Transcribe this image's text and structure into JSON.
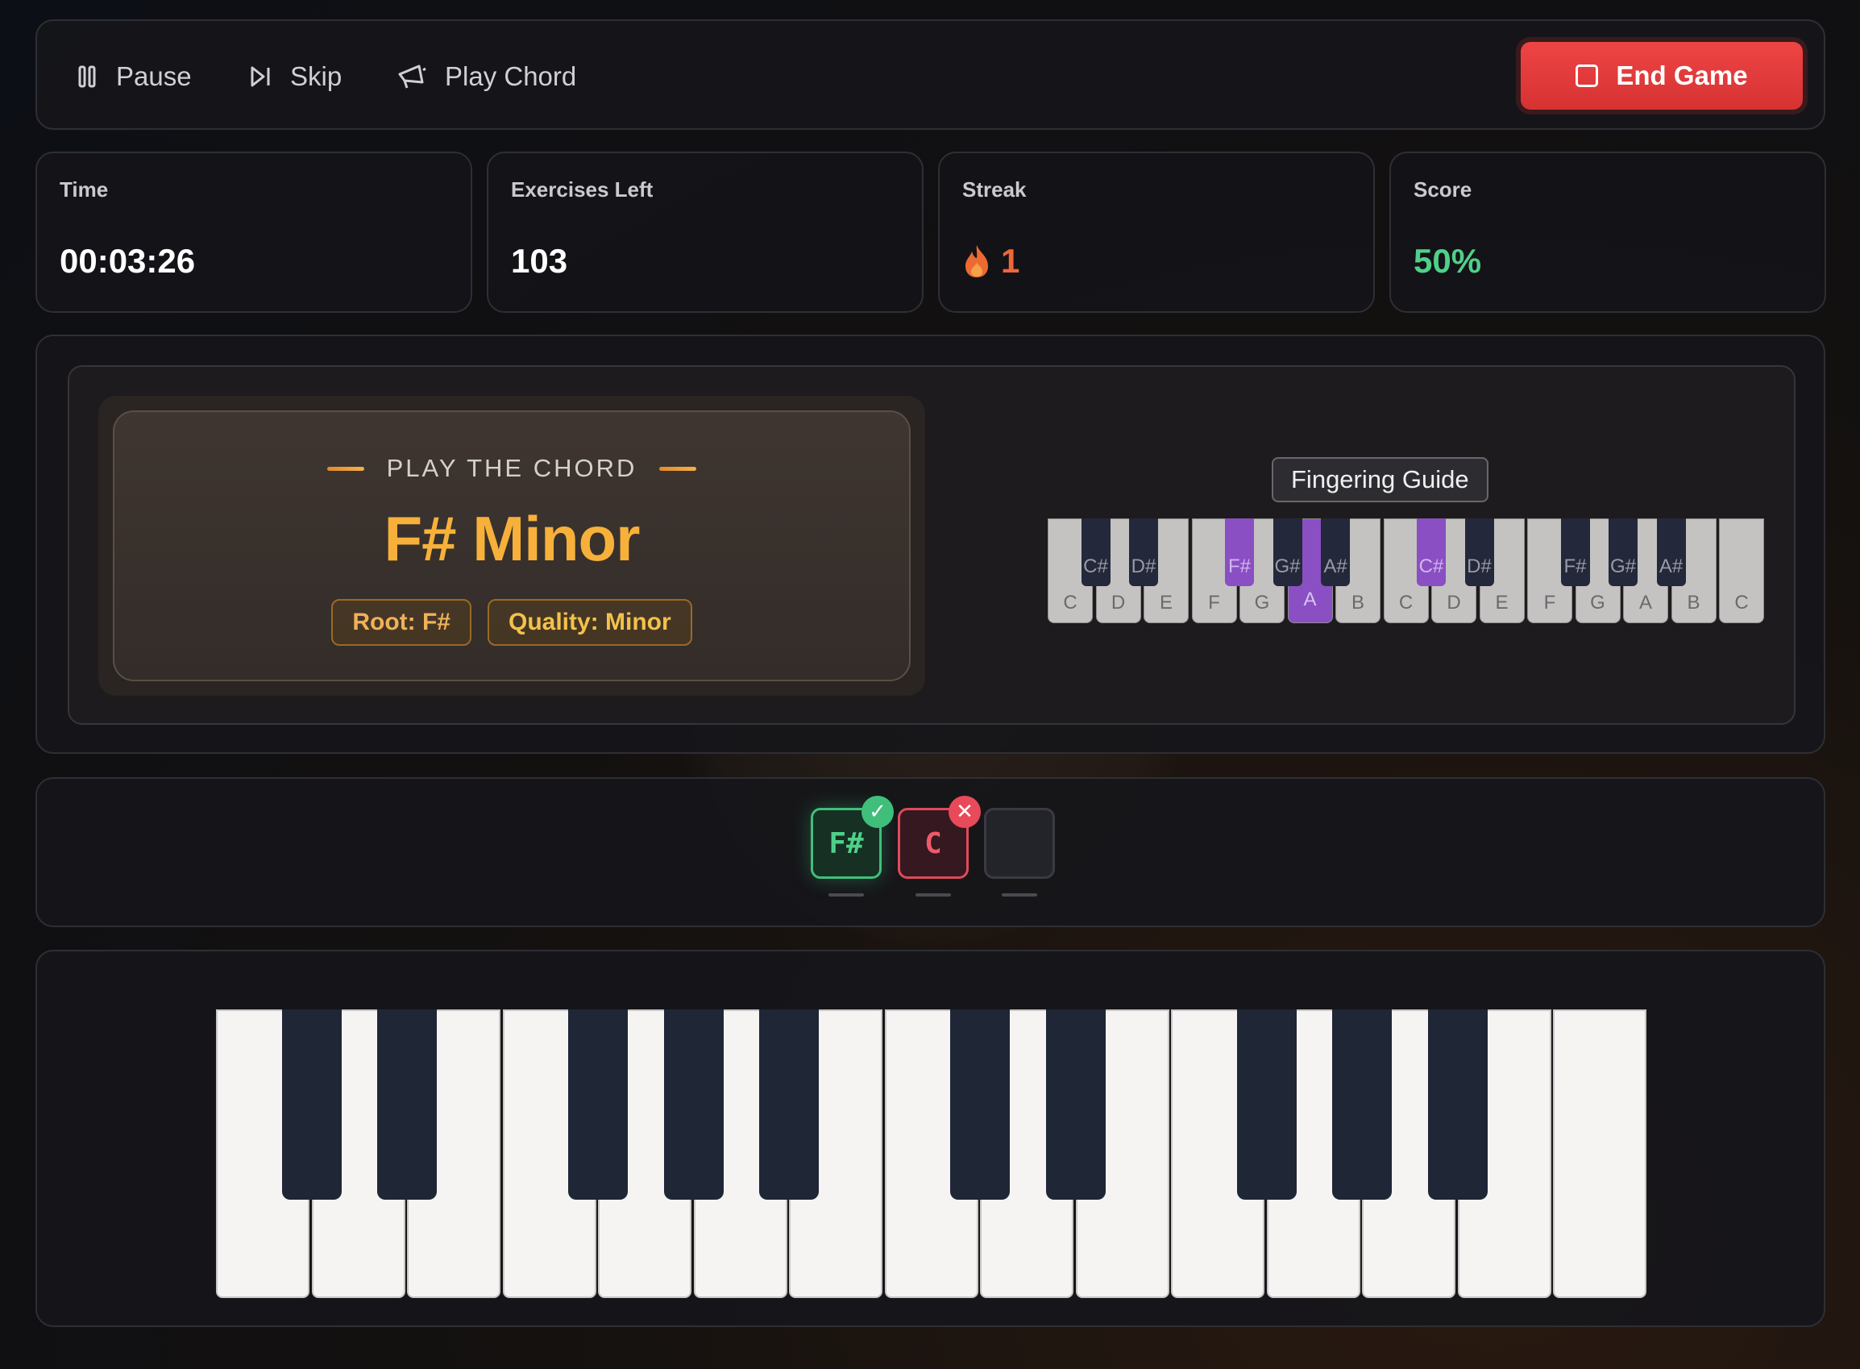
{
  "toolbar": {
    "pause_label": "Pause",
    "skip_label": "Skip",
    "play_chord_label": "Play Chord",
    "end_game_label": "End Game"
  },
  "stats": {
    "time": {
      "label": "Time",
      "value": "00:03:26"
    },
    "exercises_left": {
      "label": "Exercises Left",
      "value": "103"
    },
    "streak": {
      "label": "Streak",
      "value": "1",
      "icon": "flame-icon"
    },
    "score": {
      "label": "Score",
      "value": "50%"
    }
  },
  "challenge": {
    "prompt": "PLAY THE CHORD",
    "chord_name": "F# Minor",
    "root_tag": "Root: F#",
    "quality_tag": "Quality: Minor"
  },
  "guide": {
    "label": "Fingering Guide",
    "white_keys": [
      "C",
      "D",
      "E",
      "F",
      "G",
      "A",
      "B",
      "C",
      "D",
      "E",
      "F",
      "G",
      "A",
      "B",
      "C"
    ],
    "black_keys": [
      "C#",
      "D#",
      "F#",
      "G#",
      "A#",
      "C#",
      "D#",
      "F#",
      "G#",
      "A#"
    ],
    "highlighted": [
      "F#",
      "A",
      "C#"
    ]
  },
  "answers": {
    "slots": [
      {
        "note": "F#",
        "status": "correct"
      },
      {
        "note": "C",
        "status": "wrong"
      },
      {
        "note": "",
        "status": "empty"
      }
    ]
  },
  "colors": {
    "accent": "#f7b13a",
    "danger": "#e84040",
    "success": "#3fbf7a",
    "highlight": "#8a4fc2",
    "streak": "#f0663a",
    "score": "#4fd089"
  }
}
